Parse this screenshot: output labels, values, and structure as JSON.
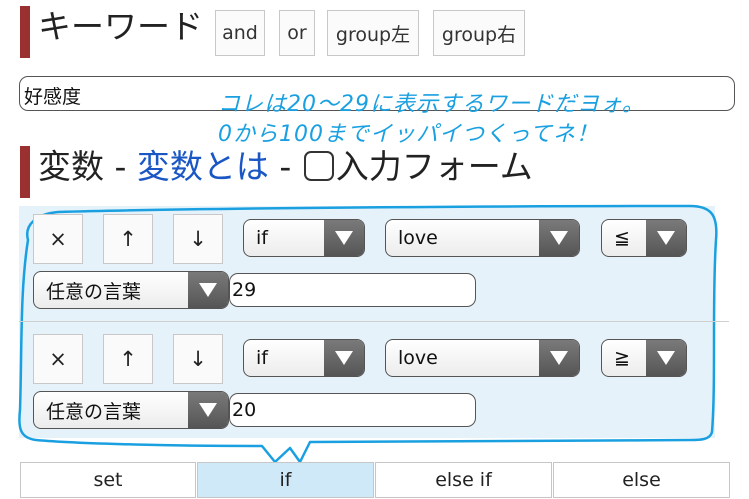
{
  "header": {
    "title": "キーワード",
    "buttons": [
      "and",
      "or",
      "group左",
      "group右"
    ]
  },
  "keyword_input": {
    "value": "好感度"
  },
  "annotation": {
    "line1": "コレは20〜29に表示するワードだヨォ。",
    "line2": "0から100までイッパイつくってネ！"
  },
  "variables_heading": {
    "title": "変数",
    "dash1": " - ",
    "link": "変数とは",
    "dash2": " - ",
    "form_label": "入力フォーム"
  },
  "conditions": [
    {
      "buttons": {
        "delete": "×",
        "up": "↑",
        "down": "↓"
      },
      "type": "if",
      "variable": "love",
      "operator": "≦",
      "word": "任意の言葉",
      "value": "29"
    },
    {
      "buttons": {
        "delete": "×",
        "up": "↑",
        "down": "↓"
      },
      "type": "if",
      "variable": "love",
      "operator": "≧",
      "word": "任意の言葉",
      "value": "20"
    }
  ],
  "tabs": [
    "set",
    "if",
    "else if",
    "else"
  ],
  "active_tab": "if",
  "colors": {
    "accent_bar": "#9b3030",
    "annotation": "#1aa0e0",
    "link": "#1a56c4",
    "active_tab": "#cfe9f9"
  }
}
